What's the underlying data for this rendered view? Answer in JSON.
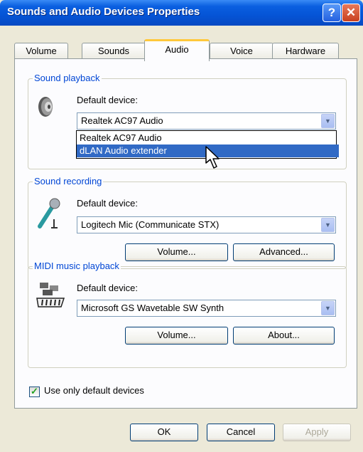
{
  "window": {
    "title": "Sounds and Audio Devices Properties"
  },
  "titlebar": {
    "help_glyph": "?",
    "close_glyph": "✕"
  },
  "tabs": [
    {
      "label": "Volume"
    },
    {
      "label": "Sounds"
    },
    {
      "label": "Audio"
    },
    {
      "label": "Voice"
    },
    {
      "label": "Hardware"
    }
  ],
  "sound_playback": {
    "group_label": "Sound playback",
    "default_label": "Default device:",
    "selected": "Realtek AC97 Audio",
    "dropdown_options": [
      "Realtek AC97 Audio",
      "dLAN Audio extender"
    ],
    "highlighted_option": "dLAN Audio extender"
  },
  "sound_recording": {
    "group_label": "Sound recording",
    "default_label": "Default device:",
    "selected": "Logitech Mic (Communicate STX)",
    "volume_button": "Volume...",
    "advanced_button": "Advanced..."
  },
  "midi_playback": {
    "group_label": "MIDI music playback",
    "default_label": "Default device:",
    "selected": "Microsoft GS Wavetable SW Synth",
    "volume_button": "Volume...",
    "about_button": "About..."
  },
  "use_default_devices": {
    "label": "Use only default devices",
    "checked": true
  },
  "footer": {
    "ok": "OK",
    "cancel": "Cancel",
    "apply": "Apply"
  },
  "icons": {
    "combo_arrow": "▼",
    "checkmark": "✓"
  },
  "colors": {
    "accent": "#0054e3",
    "group_label": "#0046d5",
    "selection": "#316ac5"
  }
}
